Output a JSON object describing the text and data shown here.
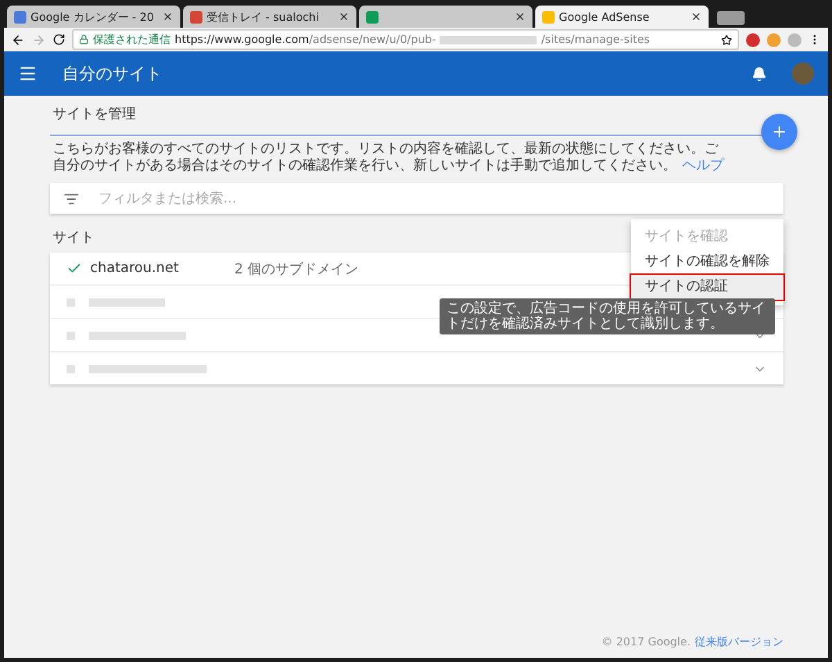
{
  "browser": {
    "tabs": [
      {
        "label": "Google カレンダー - 20",
        "selected": false
      },
      {
        "label": "受信トレイ - sualochi",
        "selected": false
      },
      {
        "selected": false
      },
      {
        "label": "Google AdSense",
        "selected": true
      }
    ],
    "security": "保護された通信",
    "url_host": "https://www.google.com",
    "url_path": "/adsense/new/u/0/pub-",
    "url_tail": "/sites/manage-sites"
  },
  "header": {
    "title": "自分のサイト"
  },
  "section": {
    "title": "サイトを管理",
    "description": "こちらがお客様のすべてのサイトのリストです。リストの内容を確認して、最新の状態にしてください。ご自分のサイトがある場合はそのサイトの確認作業を行い、新しいサイトは手動で追加してください。",
    "help_link": "ヘルプ"
  },
  "filter": {
    "placeholder": "フィルタまたは検索..."
  },
  "sites_label": "サイト",
  "sites": [
    {
      "kind": "site",
      "verified": true,
      "domain": "chatarou.net",
      "subdomains": "2 個のサブドメイン",
      "expandable": false
    },
    {
      "kind": "blurred",
      "expandable": false
    },
    {
      "kind": "blurred",
      "expandable": true
    },
    {
      "kind": "blurred",
      "expandable": true
    }
  ],
  "menu": [
    {
      "label": "サイトを確認",
      "disabled": true,
      "highlighted": false
    },
    {
      "label": "サイトの確認を解除",
      "disabled": false,
      "highlighted": false
    },
    {
      "label": "サイトの認証",
      "disabled": false,
      "highlighted": true
    }
  ],
  "tooltip": "この設定で、広告コードの使用を許可しているサイトだけを確認済みサイトとして識別します。",
  "footer": {
    "copyright": "© 2017 Google.",
    "link": "従来版バージョン"
  }
}
